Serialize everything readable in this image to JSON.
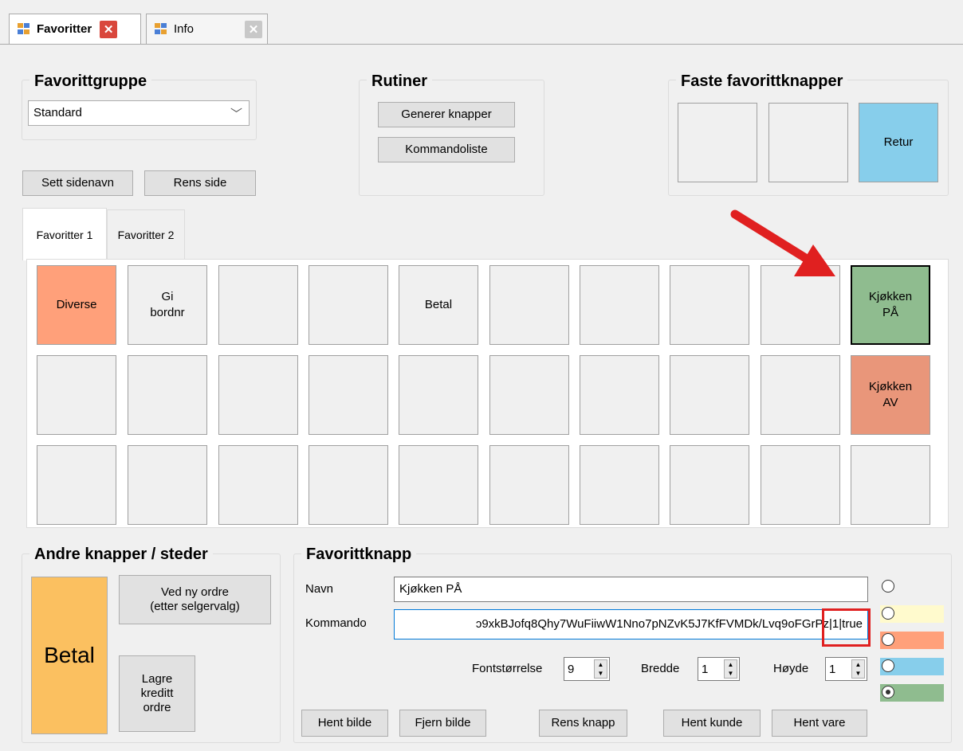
{
  "tabs": [
    {
      "label": "Favoritter"
    },
    {
      "label": "Info"
    }
  ],
  "favorittgruppe": {
    "title": "Favorittgruppe",
    "selected": "Standard"
  },
  "page_buttons": {
    "sett_sidenavn": "Sett sidenavn",
    "rens_side": "Rens side"
  },
  "rutiner": {
    "title": "Rutiner",
    "generer": "Generer knapper",
    "kommandoliste": "Kommandoliste"
  },
  "faste": {
    "title": "Faste favorittknapper",
    "buttons": [
      "",
      "",
      "Retur"
    ],
    "retur_color": "#87ceeb"
  },
  "page_tabs": [
    "Favoritter 1",
    "Favoritter 2"
  ],
  "grid": {
    "row1": [
      "Diverse",
      "Gi\nbordnr",
      "",
      "",
      "Betal",
      "",
      "",
      "",
      "",
      "Kjøkken\nPÅ"
    ],
    "row2": [
      "",
      "",
      "",
      "",
      "",
      "",
      "",
      "",
      "",
      "Kjøkken\nAV"
    ],
    "row3": [
      "",
      "",
      "",
      "",
      "",
      "",
      "",
      "",
      "",
      ""
    ],
    "colors": {
      "diverse": "#ffa07a",
      "kjokken_pa": "#8fbc8f",
      "kjokken_av": "#e9967a"
    }
  },
  "andre": {
    "title": "Andre knapper / steder",
    "betal": "Betal",
    "ved_ny_ordre": "Ved ny ordre\n(etter selgervalg)",
    "lagre": "Lagre\nkreditt\nordre",
    "betal_color": "#fbc060"
  },
  "favorittknapp": {
    "title": "Favorittknapp",
    "navn_label": "Navn",
    "navn_value": "Kjøkken PÅ",
    "kommando_label": "Kommando",
    "kommando_value": "ɔ9xkBJofq8Qhy7WuFiiwW1Nno7pNZvK5J7KfFVMDk/Lvq9oFGrPz|1|true",
    "fontstorrelse_label": "Fontstørrelse",
    "fontstorrelse_value": "9",
    "bredde_label": "Bredde",
    "bredde_value": "1",
    "hoyde_label": "Høyde",
    "hoyde_value": "1",
    "buttons": {
      "hent_bilde": "Hent bilde",
      "fjern_bilde": "Fjern bilde",
      "rens_knapp": "Rens knapp",
      "hent_kunde": "Hent kunde",
      "hent_vare": "Hent vare"
    },
    "color_options": [
      "#f0f0f0",
      "#fffacd",
      "#ffa07a",
      "#87ceeb",
      "#8fbc8f"
    ],
    "selected_color_index": 4
  },
  "annotations": {
    "arrow_color": "#e02020",
    "highlight_color": "#e02020"
  }
}
